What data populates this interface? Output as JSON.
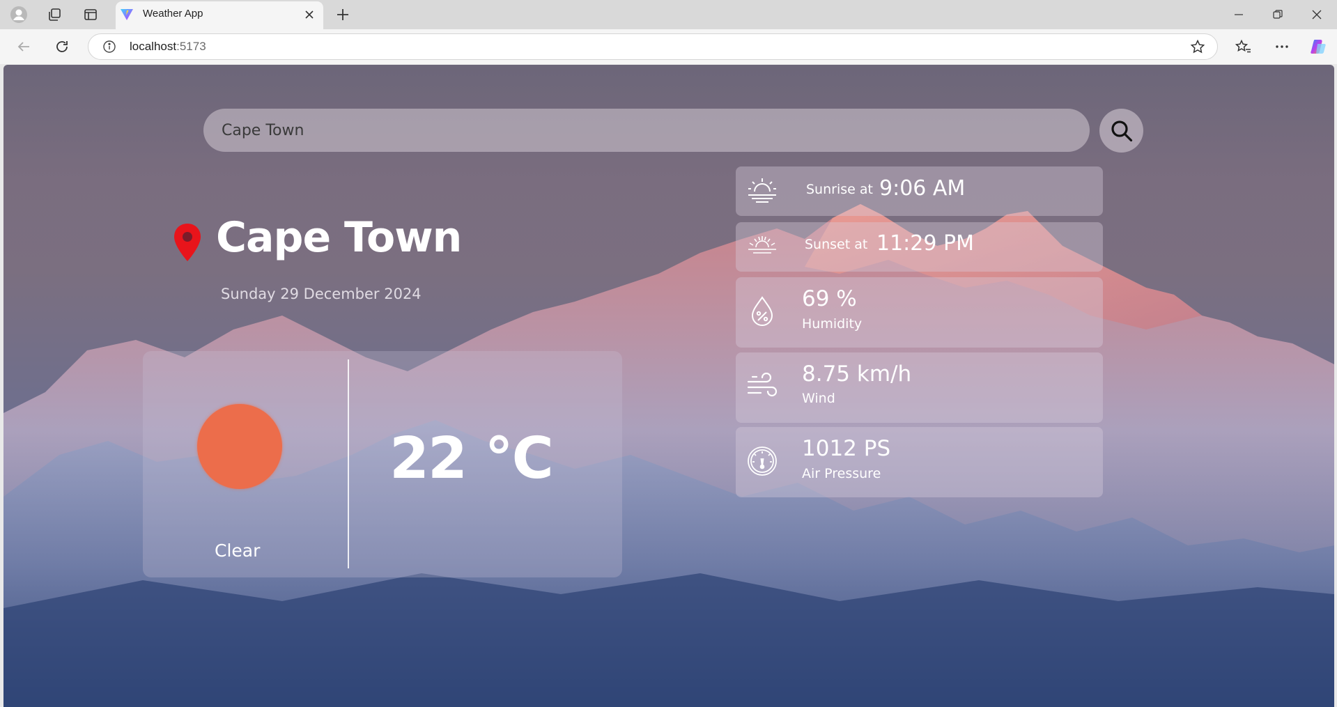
{
  "browser": {
    "tab_title": "Weather App",
    "url_host": "localhost",
    "url_port": ":5173"
  },
  "search": {
    "placeholder": "Cape Town",
    "value": ""
  },
  "location": {
    "city": "Cape Town",
    "date": "Sunday 29 December 2024"
  },
  "current": {
    "condition": "Clear",
    "temperature": "22 °C",
    "sun_color": "#ec6d4b"
  },
  "details": {
    "sunrise_label": "Sunrise at",
    "sunrise_time": "9:06 AM",
    "sunset_label": "Sunset at",
    "sunset_time": "11:29 PM",
    "humidity_value": "69 %",
    "humidity_label": "Humidity",
    "wind_value": "8.75 km/h",
    "wind_label": "Wind",
    "pressure_value": "1012 PS",
    "pressure_label": "Air Pressure"
  },
  "icons": {
    "sunrise": "sunrise-icon",
    "sunset": "sunset-icon",
    "humidity": "humidity-drop-icon",
    "wind": "wind-icon",
    "pressure": "gauge-icon",
    "location": "map-pin-icon",
    "search": "search-icon"
  },
  "colors": {
    "pin": "#e8141b",
    "accent_sun": "#ec6d4b"
  }
}
